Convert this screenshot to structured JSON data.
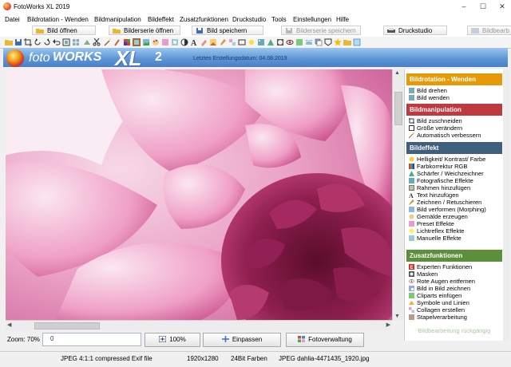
{
  "window": {
    "title": "FotoWorks XL 2019",
    "minimize": "–",
    "maximize": "☐",
    "close": "✕"
  },
  "menu": [
    "Datei",
    "Bildrotation - Wenden",
    "Bildmanipulation",
    "Bildeffekt",
    "Zusatzfunktionen",
    "Druckstudio",
    "Tools",
    "Einstellungen",
    "Hilfe"
  ],
  "buttons": {
    "open_image": "Bild öffnen",
    "open_series": "Bilderserie öffnen",
    "save_image": "Bild speichern",
    "save_series": "Bilderserie speichern",
    "print_studio": "Druckstudio",
    "expert": "Experten Funktionen",
    "image_label": "Bildbearb"
  },
  "banner": {
    "foto": "foto",
    "works": "WORKS",
    "xl": "XL",
    "version": "2",
    "date": "Letztes Erstellungsdatum: 04.08.2019"
  },
  "zoom": {
    "label": "Zoom: 70%",
    "value": "0",
    "btn_100": "100%",
    "btn_fit": "Einpassen",
    "btn_manager": "Fotoverwaltung"
  },
  "status": {
    "format": "JPEG 4:1:1 compressed Exif file",
    "size": "1920x1280",
    "depth": "24Bit Farben",
    "file": "JPEG dahlia-4471435_1920.jpg"
  },
  "panel": {
    "sections": [
      {
        "title": "Bildrotation - Wenden",
        "color": "#e59a08",
        "items": [
          "Bild drehen",
          "Bild wenden"
        ]
      },
      {
        "title": "Bildmanipulation",
        "color": "#c0393f",
        "items": [
          "Bild zuschneiden",
          "Größe verändern",
          "Automatisch verbessern"
        ]
      },
      {
        "title": "Bildeffekt",
        "color": "#3f5f7e",
        "items": [
          "Helligkeit/ Kontrast/ Farbe",
          "Farbkorrektur RGB",
          "Schärfer / Weichzeichner",
          "Fotografische Effekte",
          "Rahmen hinzufügen",
          "Text hinzufügen",
          "Zeichnen / Retuschieren",
          "Bild verformen (Morphing)",
          "Gemälde erzeugen",
          "Preset Effekte",
          "Lichtreflex Effekte",
          "Manuelle Effekte"
        ]
      },
      {
        "title": "Zusatzfunktionen",
        "color": "#5b8f3a",
        "items": [
          "Experten Funktionen",
          "Masken",
          "Rote Augen entfernen",
          "Bild in Bild zeichnen",
          "Cliparts einfügen",
          "Symbole und Linien",
          "Collagen erstellen",
          "Stapelverarbeitung"
        ]
      }
    ],
    "undo": "Bildbearbeitung rückgängig"
  }
}
